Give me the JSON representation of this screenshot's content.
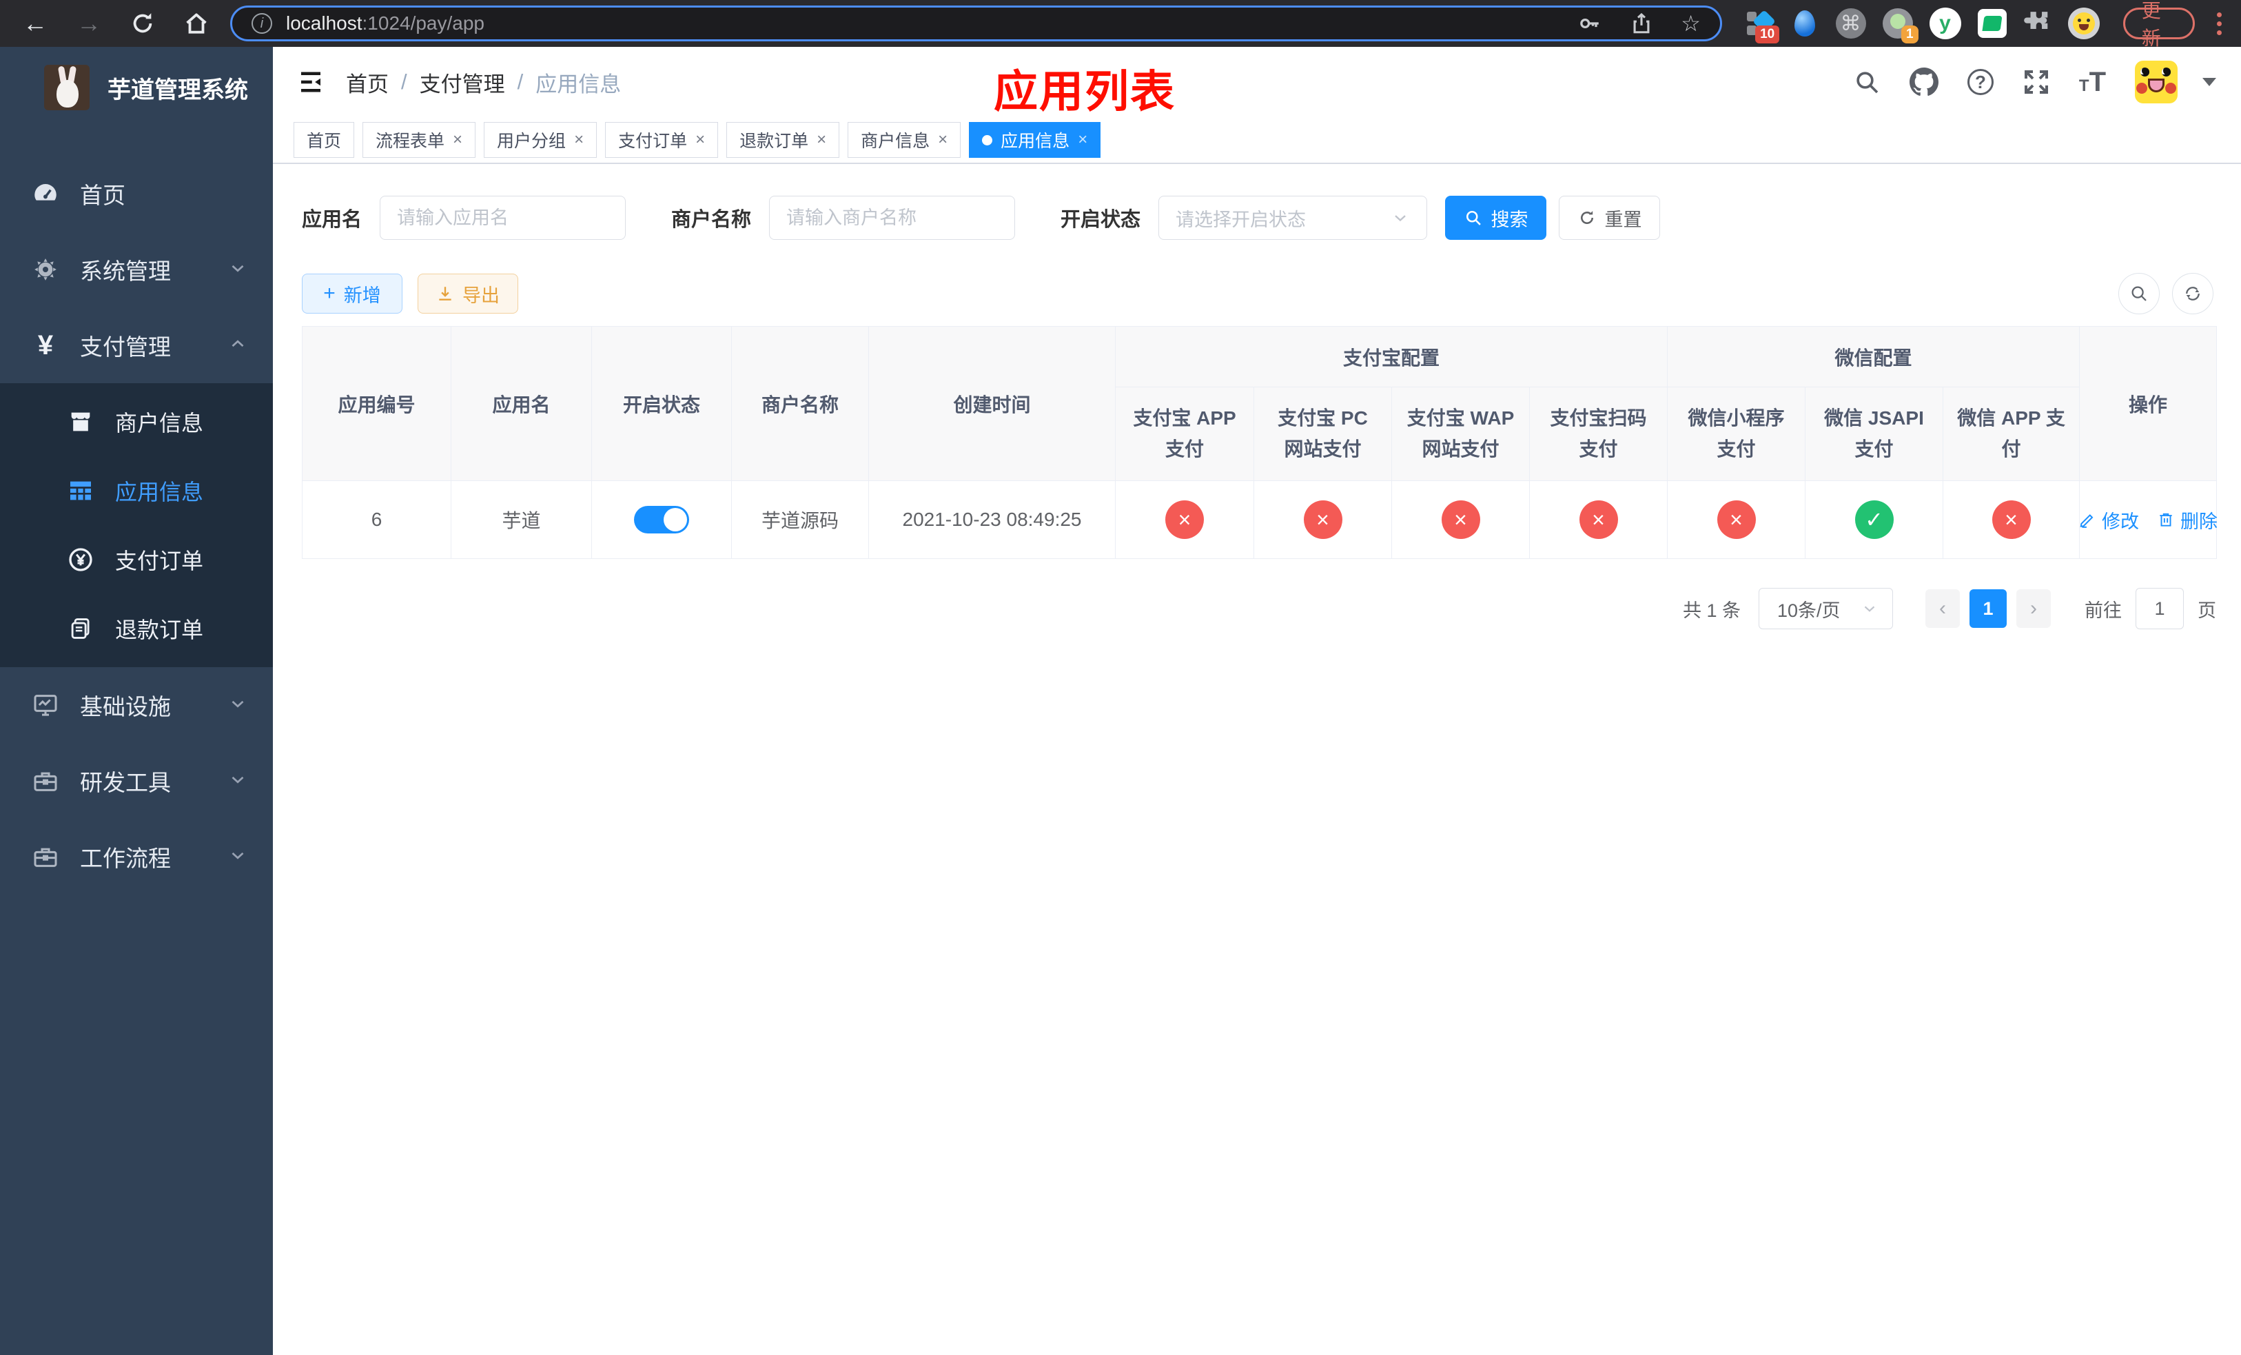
{
  "colors": {
    "accent": "#1890ff",
    "active_text": "#409eff",
    "success": "#22c272",
    "danger": "#f45a55",
    "warning": "#e6a23c",
    "sidebar_bg": "#304156",
    "sidebar_submenu_bg": "#1f2d3d",
    "chrome_bg": "#2a2a2e",
    "annotation_red": "#fe0e00",
    "update_red": "#dd7168"
  },
  "browser": {
    "url_host": "localhost",
    "url_path": ":1024/pay/app",
    "update_label": "更新",
    "extension_badges": {
      "translate": "10",
      "profile": "1"
    },
    "yuque_letter": "y",
    "command_glyph": "⌘",
    "star_glyph": "☆",
    "back_glyph": "←",
    "forward_glyph": "→"
  },
  "sidebar": {
    "title": "芋道管理系统",
    "items": [
      {
        "label": "首页",
        "icon": "dashboard-icon"
      },
      {
        "label": "系统管理",
        "icon": "gear-icon"
      },
      {
        "label": "支付管理",
        "icon": "yen-icon",
        "expanded": true
      },
      {
        "label": "基础设施",
        "icon": "monitor-icon"
      },
      {
        "label": "研发工具",
        "icon": "toolbox-icon"
      },
      {
        "label": "工作流程",
        "icon": "toolbox-icon"
      }
    ],
    "submenu": [
      {
        "label": "商户信息",
        "icon": "store-icon"
      },
      {
        "label": "应用信息",
        "icon": "grid-icon",
        "state": "active"
      },
      {
        "label": "支付订单",
        "icon": "yen-circle-icon"
      },
      {
        "label": "退款订单",
        "icon": "document-icon"
      }
    ]
  },
  "header": {
    "breadcrumb": {
      "items": [
        "首页",
        "支付管理",
        "应用信息"
      ],
      "separator": "/"
    },
    "annotation": "应用列表"
  },
  "tabs": {
    "items": [
      {
        "label": "首页"
      },
      {
        "label": "流程表单",
        "close": "×"
      },
      {
        "label": "用户分组",
        "close": "×"
      },
      {
        "label": "支付订单",
        "close": "×"
      },
      {
        "label": "退款订单",
        "close": "×"
      },
      {
        "label": "商户信息",
        "close": "×"
      },
      {
        "label": "应用信息",
        "close": "×",
        "state": "active"
      }
    ]
  },
  "filters": {
    "app_name_label": "应用名",
    "app_name_placeholder": "请输入应用名",
    "merchant_label": "商户名称",
    "merchant_placeholder": "请输入商户名称",
    "status_label": "开启状态",
    "status_placeholder": "请选择开启状态",
    "search_label": "搜索",
    "reset_label": "重置"
  },
  "toolbar": {
    "add_label": "新增",
    "export_label": "导出"
  },
  "table": {
    "columns_simple": [
      "应用编号",
      "应用名",
      "开启状态",
      "商户名称",
      "创建时间"
    ],
    "groups": [
      {
        "label": "支付宝配置",
        "children": [
          "支付宝 APP 支付",
          "支付宝 PC 网站支付",
          "支付宝 WAP 网站支付",
          "支付宝扫码支付"
        ]
      },
      {
        "label": "微信配置",
        "children": [
          "微信小程序支付",
          "微信 JSAPI 支付",
          "微信 APP 支付"
        ]
      }
    ],
    "column_action": "操作",
    "rows": [
      {
        "id": "6",
        "name": "芋道",
        "toggle_state": "on",
        "merchant": "芋道源码",
        "created_at": "2021-10-23 08:49:25",
        "statuses": [
          {
            "state": "error",
            "mark": "×"
          },
          {
            "state": "error",
            "mark": "×"
          },
          {
            "state": "error",
            "mark": "×"
          },
          {
            "state": "error",
            "mark": "×"
          },
          {
            "state": "error",
            "mark": "×"
          },
          {
            "state": "success",
            "mark": "✓"
          },
          {
            "state": "error",
            "mark": "×"
          }
        ],
        "actions": {
          "edit": "修改",
          "delete": "删除"
        }
      }
    ]
  },
  "pagination": {
    "total": "共 1 条",
    "page_size": "10条/页",
    "prev_glyph": "‹",
    "next_glyph": "›",
    "current_page": "1",
    "goto_label": "前往",
    "goto_value": "1",
    "page_unit": "页"
  }
}
